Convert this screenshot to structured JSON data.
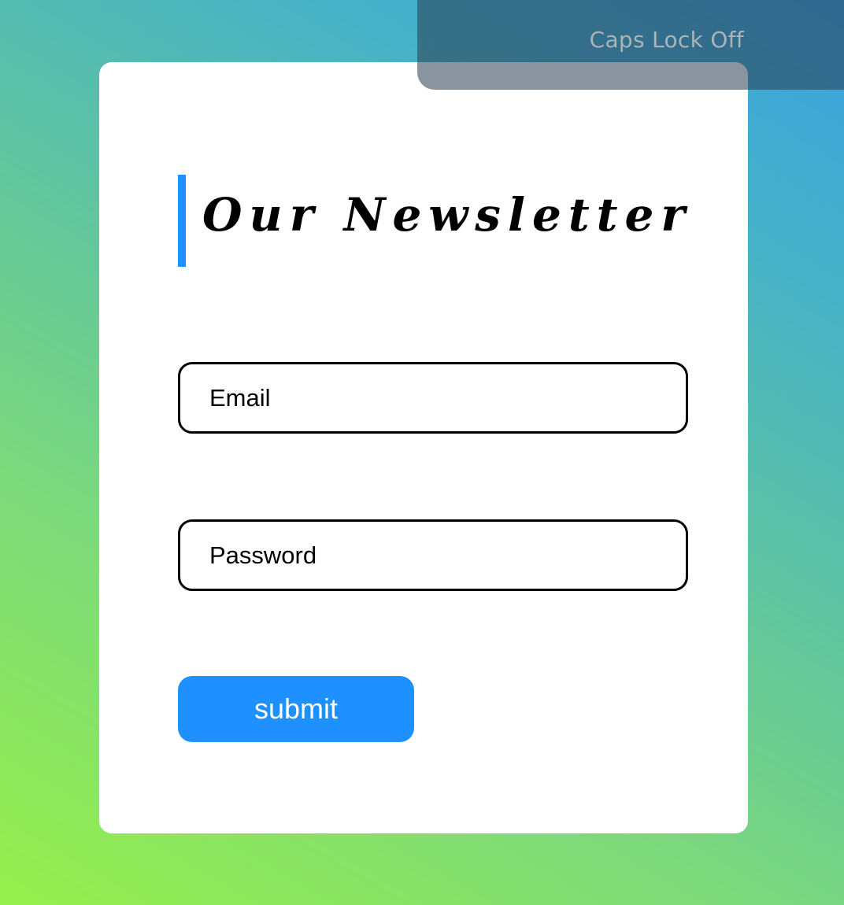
{
  "header": {
    "caps_lock_status": "Caps Lock Off"
  },
  "newsletter": {
    "title": "Our Newsletter",
    "email_placeholder": "Email",
    "password_placeholder": "Password",
    "submit_label": "submit"
  },
  "colors": {
    "accent": "#1e90ff",
    "gradient_start": "#96ef4a",
    "gradient_end": "#3aa2e0"
  }
}
